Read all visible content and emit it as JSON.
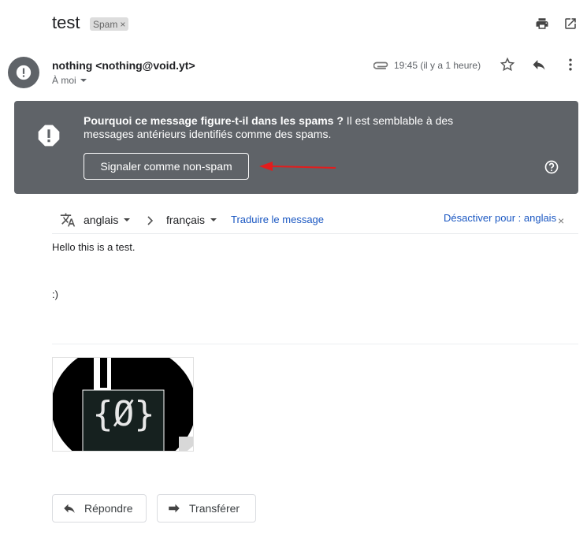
{
  "email": {
    "subject": "test",
    "label": "Spam",
    "label_remove": "×",
    "sender": "nothing <nothing@void.yt>",
    "to_me": "À moi",
    "time": "19:45 (il y a 1 heure)"
  },
  "spam_banner": {
    "title": "Pourquoi ce message figure-t-il dans les spams ?",
    "text": " Il est semblable à des messages antérieurs identifiés comme des spams.",
    "not_spam_button": "Signaler comme non-spam"
  },
  "translate": {
    "source_lang": "anglais",
    "target_lang": "français",
    "translate_link": "Traduire le message",
    "disable_link": "Désactiver pour : anglais",
    "close": "×"
  },
  "body": {
    "line1": "Hello this is a test.",
    "line2": ":)"
  },
  "attachment": {
    "logo_text": "{Ø}"
  },
  "actions": {
    "reply": "Répondre",
    "forward": "Transférer"
  },
  "colors": {
    "banner": "#5f6368",
    "link": "#1a57c2",
    "arrow": "#e21d1d"
  }
}
